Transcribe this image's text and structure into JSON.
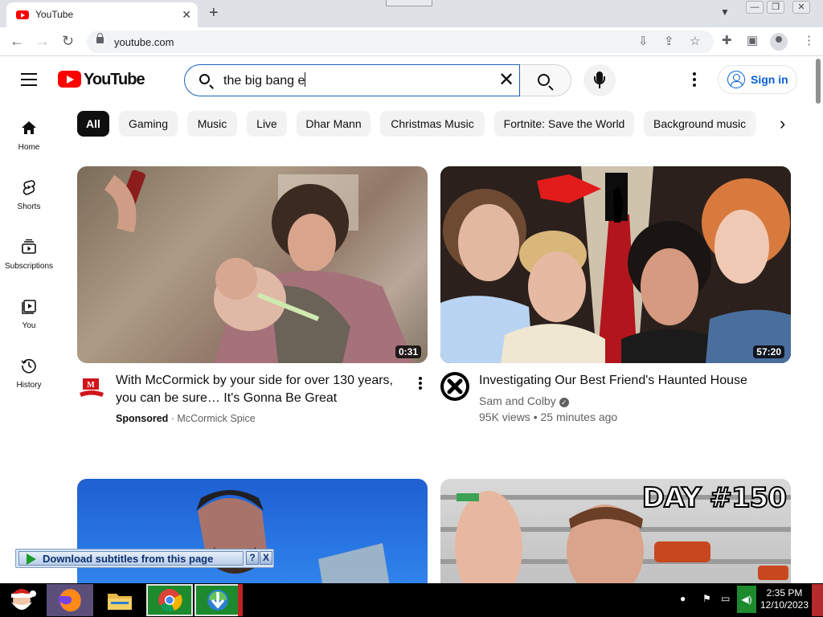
{
  "browser": {
    "tab_title": "YouTube",
    "url": "youtube.com",
    "new_tab": "+",
    "close": "✕",
    "back": "←",
    "forward": "→",
    "reload": "↻",
    "min": "—",
    "max": "❐",
    "close_win": "✕"
  },
  "youtube": {
    "logo": "YouTube",
    "search_query": "the big bang e",
    "sign_in": "Sign in",
    "guide": [
      {
        "label": "Home",
        "icon": "home-icon"
      },
      {
        "label": "Shorts",
        "icon": "shorts-icon"
      },
      {
        "label": "Subscriptions",
        "icon": "subscriptions-icon"
      },
      {
        "label": "You",
        "icon": "you-icon"
      },
      {
        "label": "History",
        "icon": "history-icon"
      }
    ],
    "chips": [
      "All",
      "Gaming",
      "Music",
      "Live",
      "Dhar Mann",
      "Christmas Music",
      "Fortnite: Save the World",
      "Background music"
    ],
    "active_chip": "All",
    "videos": [
      {
        "title": "With McCormick by your side for over 130 years, you can be sure… It's Gonna Be Great",
        "sponsored": "Sponsored",
        "separator": " · ",
        "channel": "McCormick Spice",
        "duration": "0:31"
      },
      {
        "title": "Investigating Our Best Friend's Haunted House",
        "channel": "Sam and Colby",
        "verified": "✓",
        "meta": "95K views • 25 minutes ago",
        "duration": "57:20"
      },
      {
        "overlay_text": "DAY #150"
      }
    ]
  },
  "extension": {
    "label": "Download subtitles from this page",
    "help": "?",
    "close": "X"
  },
  "taskbar": {
    "time": "2:35 PM",
    "date": "12/10/2023"
  },
  "colors": {
    "youtube_red": "#ff0000",
    "link_blue": "#065fd4",
    "search_focus": "#1c62b9",
    "chip_bg": "#f2f2f2",
    "taskbar_bg": "#000000"
  }
}
